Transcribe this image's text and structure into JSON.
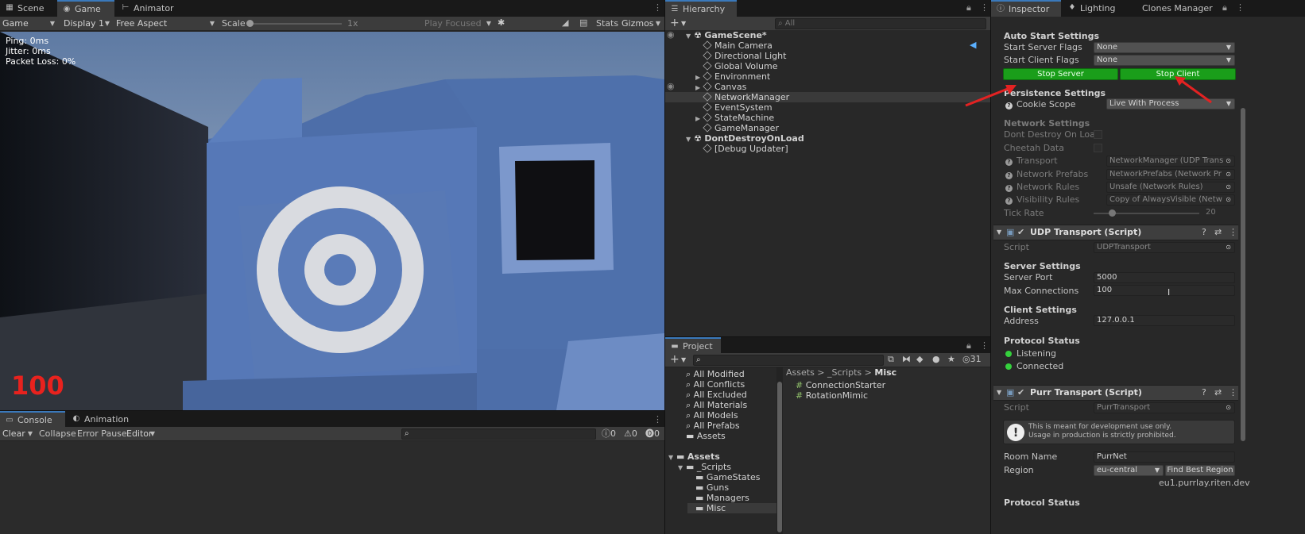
{
  "scene_tabs": {
    "scene": "Scene",
    "game": "Game",
    "animator": "Animator"
  },
  "game_toolbar": {
    "mode": "Game",
    "display": "Display 1",
    "aspect": "Free Aspect",
    "scale_label": "Scale",
    "scale_value": "1x",
    "play_focused": "Play Focused",
    "stats": "Stats",
    "gizmos": "Gizmos"
  },
  "game_view": {
    "ping": "Ping: 0ms",
    "jitter": "Jitter: 0ms",
    "packet_loss": "Packet Loss: 0%",
    "health": "100"
  },
  "console": {
    "tab_console": "Console",
    "tab_animation": "Animation",
    "clear": "Clear",
    "collapse": "Collapse",
    "error_pause": "Error Pause",
    "editor": "Editor",
    "count_log": "0",
    "count_warn": "0",
    "count_error": "0"
  },
  "hierarchy": {
    "tab": "Hierarchy",
    "search_placeholder": "All",
    "items": [
      {
        "label": "GameScene*",
        "indent": 0,
        "fold": "open",
        "kind": "scene"
      },
      {
        "label": "Main Camera",
        "indent": 1,
        "fold": "none",
        "kind": "obj"
      },
      {
        "label": "Directional Light",
        "indent": 1,
        "fold": "none",
        "kind": "obj"
      },
      {
        "label": "Global Volume",
        "indent": 1,
        "fold": "none",
        "kind": "obj"
      },
      {
        "label": "Environment",
        "indent": 1,
        "fold": "closed",
        "kind": "obj"
      },
      {
        "label": "Canvas",
        "indent": 1,
        "fold": "closed",
        "kind": "obj"
      },
      {
        "label": "NetworkManager",
        "indent": 1,
        "fold": "none",
        "kind": "obj",
        "selected": true
      },
      {
        "label": "EventSystem",
        "indent": 1,
        "fold": "none",
        "kind": "obj"
      },
      {
        "label": "StateMachine",
        "indent": 1,
        "fold": "closed",
        "kind": "obj"
      },
      {
        "label": "GameManager",
        "indent": 1,
        "fold": "none",
        "kind": "obj"
      },
      {
        "label": "DontDestroyOnLoad",
        "indent": 0,
        "fold": "open",
        "kind": "scene"
      },
      {
        "label": "[Debug Updater]",
        "indent": 1,
        "fold": "none",
        "kind": "obj"
      }
    ]
  },
  "project": {
    "tab": "Project",
    "count": "31",
    "breadcrumb": [
      "Assets",
      "_Scripts",
      "Misc"
    ],
    "favorites": [
      "All Modified",
      "All Conflicts",
      "All Excluded",
      "All Materials",
      "All Models",
      "All Prefabs",
      "Assets"
    ],
    "tree": [
      "Assets",
      "_Scripts",
      "GameStates",
      "Guns",
      "Managers",
      "Misc"
    ],
    "files": [
      "ConnectionStarter",
      "RotationMimic"
    ]
  },
  "inspector": {
    "tabs": {
      "inspector": "Inspector",
      "lighting": "Lighting",
      "clones": "Clones Manager"
    },
    "auto_start": {
      "header": "Auto Start Settings",
      "server_label": "Start Server Flags",
      "server_value": "None",
      "client_label": "Start Client Flags",
      "client_value": "None",
      "stop_server": "Stop Server",
      "stop_client": "Stop Client"
    },
    "persistence": {
      "header": "Persistence Settings",
      "cookie_label": "Cookie Scope",
      "cookie_value": "Live With Process"
    },
    "network": {
      "header": "Network Settings",
      "dont_destroy": "Dont Destroy On Load",
      "cheetah": "Cheetah Data",
      "transport_label": "Transport",
      "transport_value": "NetworkManager (UDP Trans",
      "prefabs_label": "Network Prefabs",
      "prefabs_value": "NetworkPrefabs (Network Pr",
      "rules_label": "Network Rules",
      "rules_value": "Unsafe (Network Rules)",
      "visibility_label": "Visibility Rules",
      "visibility_value": "Copy of AlwaysVisible (Netw",
      "tick_label": "Tick Rate",
      "tick_value": "20",
      "tick_fraction": 0.17
    },
    "udp": {
      "title": "UDP Transport (Script)",
      "script_label": "Script",
      "script_value": "UDPTransport",
      "server_header": "Server Settings",
      "port_label": "Server Port",
      "port_value": "5000",
      "max_label": "Max Connections",
      "max_value": "100",
      "client_header": "Client Settings",
      "address_label": "Address",
      "address_value": "127.0.0.1",
      "status_header": "Protocol Status",
      "listening": "Listening",
      "connected": "Connected"
    },
    "purr": {
      "title": "Purr Transport (Script)",
      "script_label": "Script",
      "script_value": "PurrTransport",
      "info_line1": "This is meant for development use only.",
      "info_line2": "Usage in production is strictly prohibited.",
      "room_label": "Room Name",
      "room_value": "PurrNet",
      "region_label": "Region",
      "region_value": "eu-central",
      "find_best": "Find Best Region",
      "server_url": "eu1.purrlay.riten.dev",
      "status_header": "Protocol Status"
    }
  },
  "colors": {
    "accent": "#3a79bb",
    "stop_button": "#1a9e1a",
    "status_green": "#35d13d",
    "arrow_red": "#e32222",
    "health_red": "#e8221e"
  }
}
